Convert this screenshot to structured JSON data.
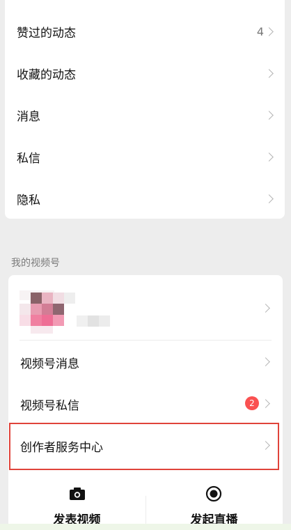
{
  "menu": {
    "items": [
      {
        "label": "赞过的动态",
        "count": "4"
      },
      {
        "label": "收藏的动态",
        "count": ""
      },
      {
        "label": "消息",
        "count": ""
      },
      {
        "label": "私信",
        "count": ""
      },
      {
        "label": "隐私",
        "count": ""
      }
    ]
  },
  "channels": {
    "section_title": "我的视频号",
    "items": [
      {
        "label": "视频号消息"
      },
      {
        "label": "视频号私信",
        "badge": "2"
      },
      {
        "label": "创作者服务中心"
      }
    ]
  },
  "actions": {
    "post_video": "发表视频",
    "start_live": "发起直播"
  },
  "colors": {
    "badge": "#fa5151",
    "highlight_border": "#e0433a",
    "background": "#ededed"
  }
}
